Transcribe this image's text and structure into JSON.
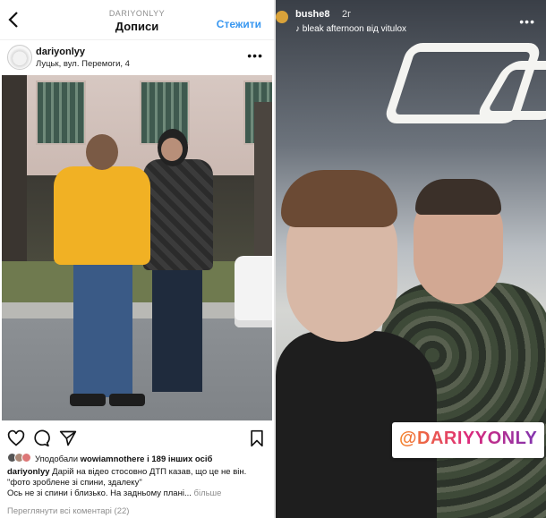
{
  "left": {
    "header": {
      "username": "DARIYONLYY",
      "title": "Дописи",
      "follow_label": "Стежити"
    },
    "post": {
      "username": "dariyonlyy",
      "location": "Луцьк, вул. Перемоги, 4",
      "likes_prefix": "Уподобали ",
      "likes_user": "wowiamnothere",
      "likes_suffix": " і 189 інших осіб",
      "caption_user": "dariyonlyy",
      "caption_line1": " Дарій на відео стосовно ДТП казав, що це не він.",
      "caption_line2": "\"фото зроблене зі спини, здалеку\"",
      "caption_line3": "Ось не зі спини і близько. На задньому плані...",
      "more_label": "більше",
      "view_comments": "Переглянути всі коментарі (22)"
    }
  },
  "right": {
    "story": {
      "username": "bushe8",
      "time": "2г",
      "music_icon": "music-note-icon",
      "music_track": "bleak afternoon",
      "music_sep": " від ",
      "music_artist": "vitulox",
      "mention_tag": "@DARIYYONLY"
    }
  },
  "colors": {
    "link_blue": "#3897f0",
    "muted": "#8e8e8e",
    "mention_gradient": [
      "#f58529",
      "#dd2a7b",
      "#8134af"
    ]
  }
}
